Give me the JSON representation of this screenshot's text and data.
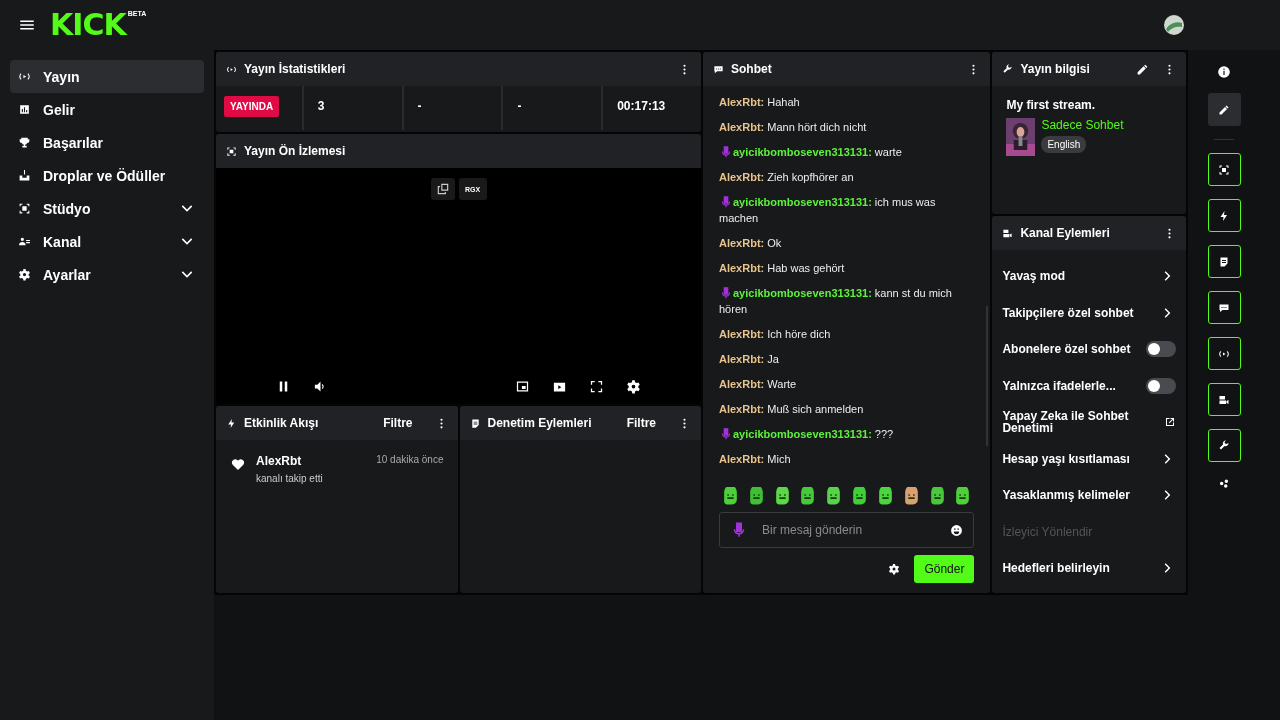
{
  "brand": {
    "logo": "KICK",
    "badge": "BETA"
  },
  "sidebar": {
    "items": [
      {
        "label": "Yayın",
        "selected": true,
        "expandable": false
      },
      {
        "label": "Gelir",
        "selected": false,
        "expandable": false
      },
      {
        "label": "Başarılar",
        "selected": false,
        "expandable": false
      },
      {
        "label": "Droplar ve Ödüller",
        "selected": false,
        "expandable": false
      },
      {
        "label": "Stüdyo",
        "selected": false,
        "expandable": true
      },
      {
        "label": "Kanal",
        "selected": false,
        "expandable": true
      },
      {
        "label": "Ayarlar",
        "selected": false,
        "expandable": true
      }
    ]
  },
  "stats": {
    "title": "Yayın İstatistikleri",
    "status": "YAYINDA",
    "values": [
      "3",
      "-",
      "-",
      "00:17:13"
    ]
  },
  "preview": {
    "title": "Yayın Ön İzlemesi",
    "source_label": "RGX"
  },
  "activity": {
    "title": "Etkinlik Akışı",
    "filter": "Filtre",
    "events": [
      {
        "user": "AlexRbt",
        "action": "kanalı takip etti",
        "time": "10 dakika önce"
      }
    ]
  },
  "moderation": {
    "title": "Denetim Eylemleri",
    "filter": "Filtre"
  },
  "chat": {
    "title": "Sohbet",
    "messages": [
      {
        "kind": "plain",
        "user": "AlexRbt:",
        "text": "Hahah",
        "color": "#e8c48f"
      },
      {
        "kind": "plain",
        "user": "AlexRbt:",
        "text": "Mann hört dich nicht",
        "color": "#e8c48f"
      },
      {
        "kind": "badged",
        "user": "ayicikbomboseven313131:",
        "text": "warte",
        "color": "#5ef23c"
      },
      {
        "kind": "plain",
        "user": "AlexRbt:",
        "text": "Zieh kopfhörer an",
        "color": "#e8c48f"
      },
      {
        "kind": "badged",
        "user": "ayicikbomboseven313131:",
        "text": "ich mus was machen",
        "color": "#5ef23c"
      },
      {
        "kind": "plain",
        "user": "AlexRbt:",
        "text": "Ok",
        "color": "#e8c48f"
      },
      {
        "kind": "plain",
        "user": "AlexRbt:",
        "text": "Hab was gehört",
        "color": "#e8c48f"
      },
      {
        "kind": "badged",
        "user": "ayicikbomboseven313131:",
        "text": "kann st du mich hören",
        "color": "#5ef23c"
      },
      {
        "kind": "plain",
        "user": "AlexRbt:",
        "text": "Ich höre dich",
        "color": "#e8c48f"
      },
      {
        "kind": "plain",
        "user": "AlexRbt:",
        "text": "Ja",
        "color": "#e8c48f"
      },
      {
        "kind": "plain",
        "user": "AlexRbt:",
        "text": "Warte",
        "color": "#e8c48f"
      },
      {
        "kind": "plain",
        "user": "AlexRbt:",
        "text": "Muß sich anmelden",
        "color": "#e8c48f"
      },
      {
        "kind": "badged",
        "user": "ayicikbomboseven313131:",
        "text": "???",
        "color": "#5ef23c"
      },
      {
        "kind": "plain",
        "user": "AlexRbt:",
        "text": "Mich",
        "color": "#e8c48f"
      }
    ],
    "input": {
      "placeholder": "Bir mesaj gönderin"
    },
    "send": "Gönder"
  },
  "stream_info": {
    "title": "Yayın bilgisi",
    "stream_title": "My first stream.",
    "category": "Sadece Sohbet",
    "tag": "English"
  },
  "channel_actions": {
    "title": "Kanal Eylemleri",
    "items": [
      {
        "kind": "link",
        "label": "Yavaş mod"
      },
      {
        "kind": "link",
        "label": "Takipçilere özel sohbet"
      },
      {
        "kind": "toggle",
        "label": "Abonelere özel sohbet",
        "on": false
      },
      {
        "kind": "toggle",
        "label": "Yalnızca ifadelerle...",
        "on": false
      },
      {
        "kind": "external",
        "label": "Yapay Zeka ile Sohbet Denetimi"
      },
      {
        "kind": "link",
        "label": "Hesap yaşı kısıtlaması"
      },
      {
        "kind": "link",
        "label": "Yasaklanmış kelimeler"
      },
      {
        "kind": "section",
        "label": "İzleyici Yönlendir"
      },
      {
        "kind": "link",
        "label": "Hedefleri belirleyin"
      }
    ]
  },
  "rail": [
    {
      "kind": "info",
      "selected": false
    },
    {
      "kind": "pencil",
      "selected": true
    },
    {
      "kind": "studio",
      "selected": false
    },
    {
      "kind": "bolt",
      "selected": false
    },
    {
      "kind": "doc",
      "selected": false
    },
    {
      "kind": "chat",
      "selected": false
    },
    {
      "kind": "broadcast",
      "selected": false
    },
    {
      "kind": "channel",
      "selected": false
    },
    {
      "kind": "wrench",
      "selected": false
    },
    {
      "kind": "cluster",
      "selected": false
    }
  ]
}
